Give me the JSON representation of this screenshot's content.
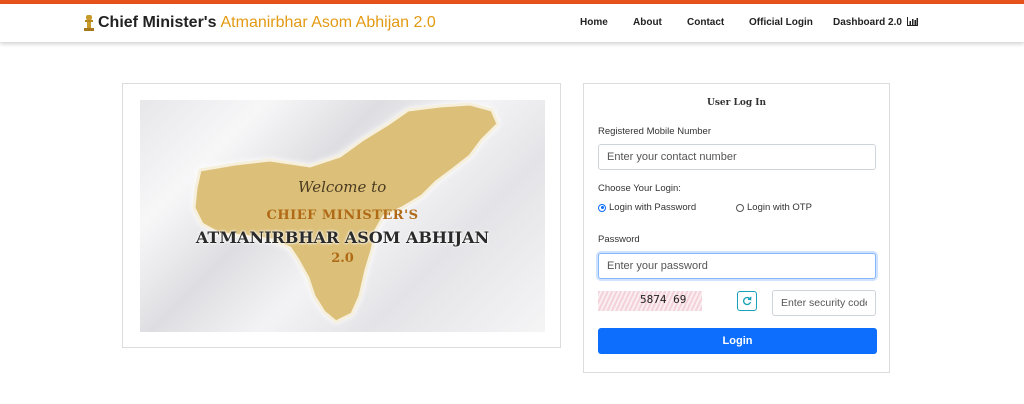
{
  "brand": {
    "title_part1": "Chief Minister's",
    "title_part2": "Atmanirbhar Asom Abhijan 2.0",
    "accent_color": "#e39a12",
    "topbar_color": "#e8531c"
  },
  "nav": {
    "home": "Home",
    "about": "About",
    "contact": "Contact",
    "official_login": "Official Login",
    "dashboard": "Dashboard 2.0",
    "dashboard_icon": "bar-chart-icon"
  },
  "banner": {
    "welcome": "Welcome to",
    "line1": "CHIEF MINISTER'S",
    "line2": "ATMANIRBHAR ASOM ABHIJAN",
    "line3": "2.0"
  },
  "login": {
    "title": "User Log In",
    "mobile_label": "Registered Mobile Number",
    "mobile_placeholder": "Enter your contact number",
    "choose_label": "Choose Your Login:",
    "option_password": "Login with Password",
    "option_otp": "Login with OTP",
    "selected_option": "Login with Password",
    "password_label": "Password",
    "password_placeholder": "Enter your password",
    "captcha_text": "5874 69",
    "refresh_icon": "refresh-icon",
    "security_placeholder": "Enter security code",
    "submit": "Login",
    "button_color": "#0d6efd"
  }
}
